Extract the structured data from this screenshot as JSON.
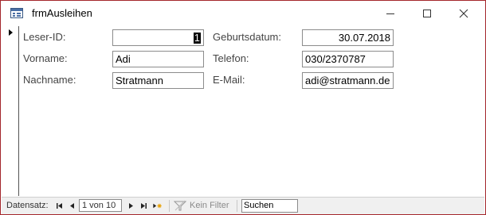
{
  "window": {
    "title": "frmAusleihen",
    "icon": "form-icon",
    "controls": [
      "minimize-icon",
      "maximize-icon",
      "close-icon"
    ]
  },
  "form": {
    "leser_id": {
      "label": "Leser-ID:",
      "value": "1"
    },
    "vorname": {
      "label": "Vorname:",
      "value": "Adi"
    },
    "nachname": {
      "label": "Nachname:",
      "value": "Stratmann"
    },
    "geburtsdatum": {
      "label": "Geburtsdatum:",
      "value": "30.07.2018"
    },
    "telefon": {
      "label": "Telefon:",
      "value": "030/2370787"
    },
    "email": {
      "label": "E-Mail:",
      "value": "adi@stratmann.de"
    }
  },
  "navigation": {
    "label": "Datensatz:",
    "position": "1 von 10",
    "filter_label": "Kein Filter",
    "search_value": "Suchen"
  },
  "colors": {
    "window_border": "#a4262c",
    "navbar_bg": "#f0f0f0"
  }
}
